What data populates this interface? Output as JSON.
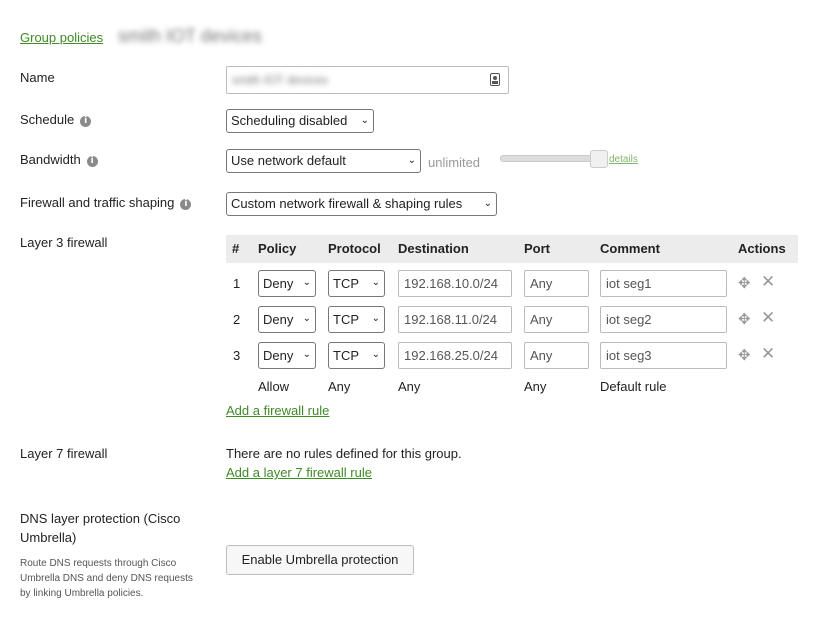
{
  "breadcrumb": {
    "parent": "Group policies",
    "current": "smith IOT devices"
  },
  "name": {
    "label": "Name",
    "value": "smith IOT devices"
  },
  "schedule": {
    "label": "Schedule",
    "selected": "Scheduling disabled"
  },
  "bandwidth": {
    "label": "Bandwidth",
    "selected": "Use network default",
    "limit_text": "unlimited",
    "details_link": "details",
    "slider_level_fraction": 1.0
  },
  "firewall_shaping": {
    "label": "Firewall and traffic shaping",
    "selected": "Custom network firewall & shaping rules"
  },
  "layer3": {
    "label": "Layer 3 firewall",
    "columns": [
      "#",
      "Policy",
      "Protocol",
      "Destination",
      "Port",
      "Comment",
      "Actions"
    ],
    "rules": [
      {
        "num": "1",
        "policy": "Deny",
        "protocol": "TCP",
        "destination": "192.168.10.0/24",
        "port": "Any",
        "comment": "iot seg1"
      },
      {
        "num": "2",
        "policy": "Deny",
        "protocol": "TCP",
        "destination": "192.168.11.0/24",
        "port": "Any",
        "comment": "iot seg2"
      },
      {
        "num": "3",
        "policy": "Deny",
        "protocol": "TCP",
        "destination": "192.168.25.0/24",
        "port": "Any",
        "comment": "iot seg3"
      }
    ],
    "default_rule": {
      "policy": "Allow",
      "protocol": "Any",
      "destination": "Any",
      "port": "Any",
      "comment": "Default rule"
    },
    "add_link": "Add a firewall rule"
  },
  "layer7": {
    "label": "Layer 7 firewall",
    "empty_text": "There are no rules defined for this group.",
    "add_link": "Add a layer 7 firewall rule"
  },
  "dns": {
    "label": "DNS layer protection (Cisco Umbrella)",
    "description": "Route DNS requests through Cisco Umbrella DNS and deny DNS requests by linking Umbrella policies.",
    "button": "Enable Umbrella protection"
  }
}
